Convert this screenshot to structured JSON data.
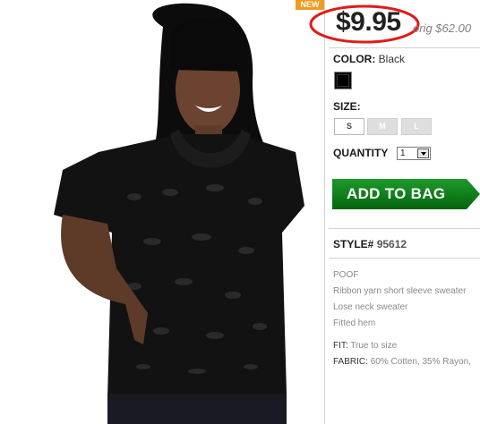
{
  "badge": {
    "new": "NEW"
  },
  "price": {
    "current": "$9.95",
    "original": "orig $62.00"
  },
  "color": {
    "label": "COLOR:",
    "value": "Black",
    "swatch": "#000000"
  },
  "size": {
    "label": "SIZE:",
    "options": [
      "S",
      "M",
      "L"
    ],
    "selected": "S"
  },
  "quantity": {
    "label": "QUANTITY",
    "value": "1"
  },
  "cart": {
    "add_label": "ADD TO BAG",
    "accent": "#0a7a14"
  },
  "style": {
    "label": "STYLE#",
    "number": "95612"
  },
  "description": {
    "lines": [
      "POOF",
      "Ribbon yarn short sleeve sweater",
      "Lose neck sweater",
      "Fitted hem"
    ]
  },
  "specs": {
    "fit_label": "FIT:",
    "fit_value": "True to size",
    "fabric_label": "FABRIC:",
    "fabric_value": "60% Cotten, 35% Rayon,"
  },
  "highlight": {
    "circle_color": "#e01b1b"
  }
}
